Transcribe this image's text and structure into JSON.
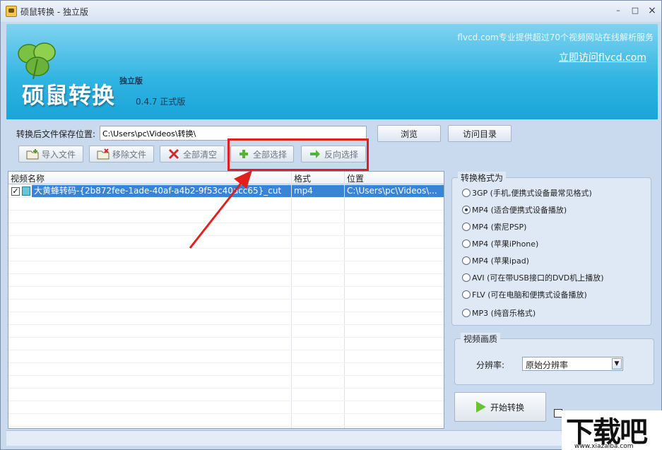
{
  "window": {
    "title": "硕鼠转换 - 独立版",
    "minimize": "–",
    "maximize": "□",
    "close": "×"
  },
  "banner": {
    "title": "硕鼠转换",
    "edition": "独立版",
    "version": "0.4.7 正式版",
    "slogan": "flvcd.com专业提供超过70个视频网站在线解析服务",
    "link": "立即访问flvcd.com"
  },
  "save": {
    "label": "转换后文件保存位置:",
    "path": "C:\\Users\\pc\\Videos\\转换\\",
    "browse": "浏览",
    "visit_dir": "访问目录"
  },
  "toolbar": {
    "import": "导入文件",
    "remove": "移除文件",
    "clear_all": "全部清空",
    "select_all": "全部选择",
    "invert": "反向选择"
  },
  "table": {
    "columns": [
      "视频名称",
      "格式",
      "位置"
    ],
    "rows": [
      {
        "name": "大黄蜂转码-{2b872fee-1ade-40af-a4b2-9f53c40acc65}_cut",
        "format": "mp4",
        "location": "C:\\Users\\pc\\Videos\\...",
        "checked": "✓"
      }
    ]
  },
  "format": {
    "title": "转换格式为",
    "options": [
      {
        "label": "3GP (手机,便携式设备最常见格式)",
        "selected": false
      },
      {
        "label": "MP4 (适合便携式设备播放)",
        "selected": true
      },
      {
        "label": "MP4 (索尼PSP)",
        "selected": false
      },
      {
        "label": "MP4 (苹果iPhone)",
        "selected": false
      },
      {
        "label": "MP4 (苹果ipad)",
        "selected": false
      },
      {
        "label": "AVI (可在带USB接口的DVD机上播放)",
        "selected": false
      },
      {
        "label": "FLV (可在电脑和便携式设备播放)",
        "selected": false
      },
      {
        "label": "MP3 (纯音乐格式)",
        "selected": false
      }
    ]
  },
  "quality": {
    "title": "视频画质",
    "resolution_label": "分辨率:",
    "resolution_value": "原始分辨率"
  },
  "start": {
    "label": "开始转换"
  },
  "watermark": {
    "text": "下载吧",
    "url": "www.xiazaiba.com"
  },
  "colors": {
    "banner": "#2fb3e2",
    "selected_row": "#3a84d6",
    "highlight_box": "#e0201b",
    "arrow": "#e0201b"
  }
}
